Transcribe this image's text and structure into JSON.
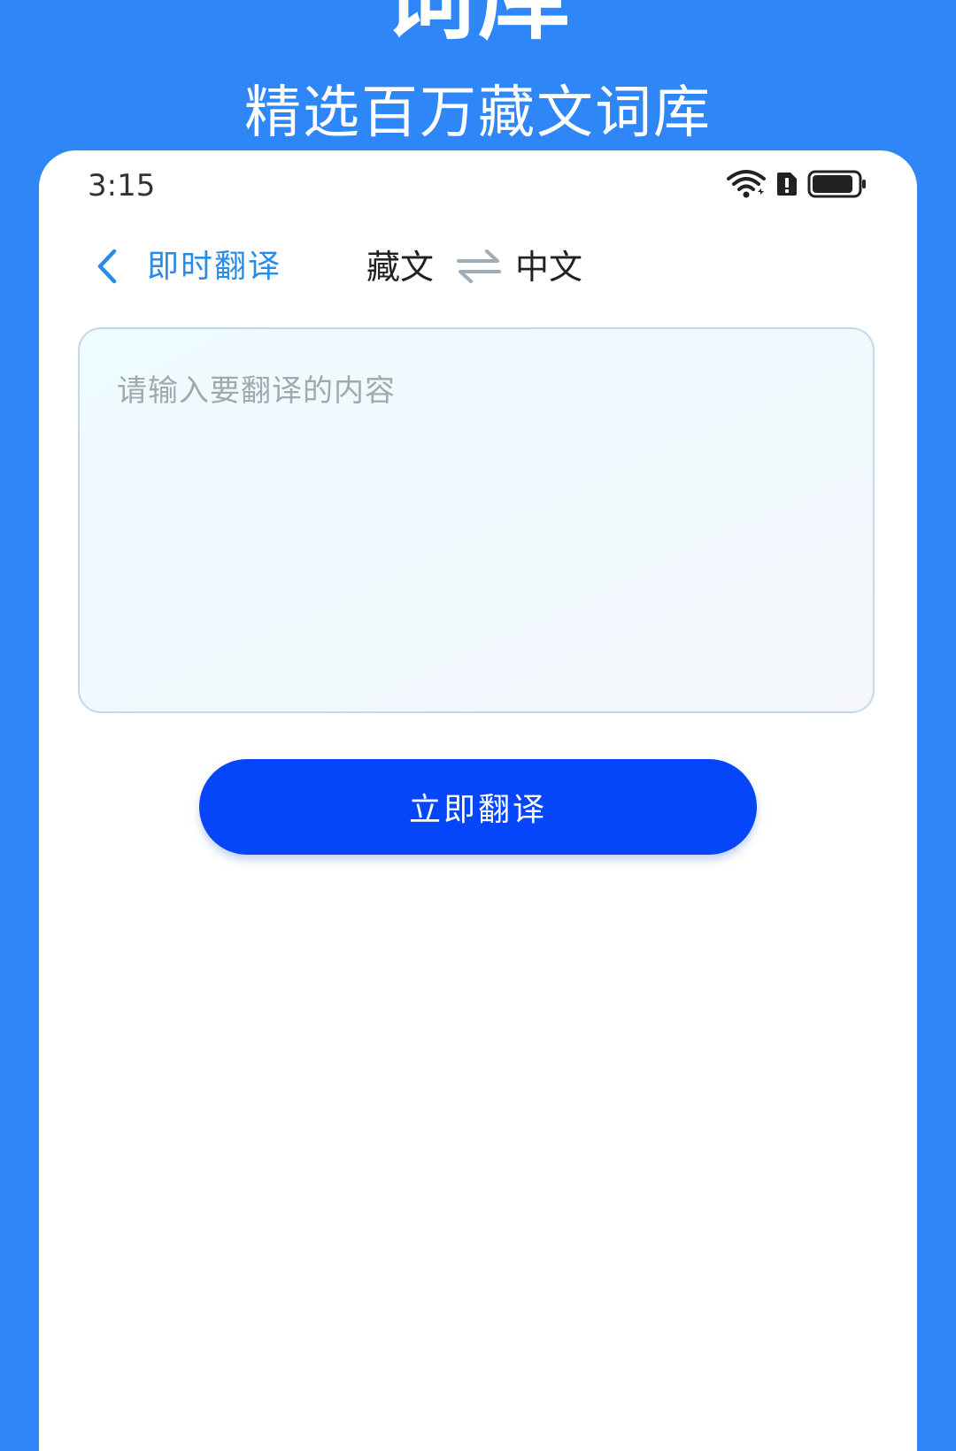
{
  "promo": {
    "title": "词库",
    "subtitle": "精选百万藏文词库"
  },
  "status_bar": {
    "time": "3:15",
    "icons": [
      "wifi-icon",
      "alert-icon",
      "battery-icon"
    ],
    "battery_level": 0.9
  },
  "nav": {
    "back_icon": "chevron-left-icon",
    "title": "即时翻译",
    "source_lang": "藏文",
    "swap_icon": "swap-arrows-icon",
    "target_lang": "中文"
  },
  "input": {
    "placeholder": "请输入要翻译的内容",
    "value": ""
  },
  "translate_button": {
    "label": "立即翻译"
  },
  "colors": {
    "background": "#2f86f7",
    "accent_text": "#2a8be8",
    "button": "#0546fb"
  }
}
